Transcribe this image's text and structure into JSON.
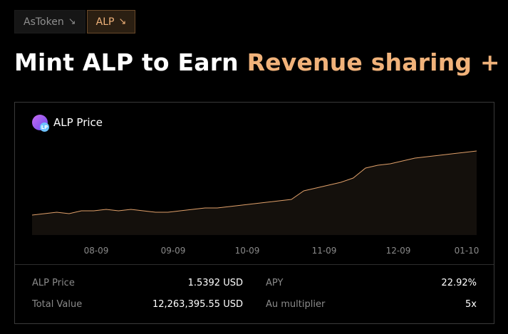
{
  "tabs": [
    {
      "label": "AsToken",
      "icon": "arrow-down-right-icon",
      "active": false
    },
    {
      "label": "ALP",
      "icon": "arrow-down-right-icon",
      "active": true
    }
  ],
  "headline": {
    "main": "Mint ALP to Earn ",
    "accent": "Revenue sharing + A"
  },
  "colors": {
    "accent": "#f0b27a",
    "line": "#e0a06a"
  },
  "card": {
    "title": "ALP Price",
    "logo_badge": "LP"
  },
  "chart_data": {
    "type": "area",
    "x_ticks": [
      "08-09",
      "09-09",
      "10-09",
      "11-09",
      "12-09",
      "01-10"
    ],
    "series": [
      {
        "values": [
          1.09,
          1.1,
          1.11,
          1.1,
          1.12,
          1.12,
          1.13,
          1.12,
          1.13,
          1.12,
          1.11,
          1.11,
          1.12,
          1.13,
          1.14,
          1.14,
          1.15,
          1.16,
          1.17,
          1.18,
          1.19,
          1.2,
          1.26,
          1.28,
          1.3,
          1.32,
          1.35,
          1.42,
          1.44,
          1.45,
          1.47,
          1.49,
          1.5,
          1.51,
          1.52,
          1.53,
          1.54
        ]
      }
    ],
    "grid": false
  },
  "stats": {
    "alp_price_label": "ALP Price",
    "alp_price_value": "1.5392 USD",
    "total_value_label": "Total Value",
    "total_value_value": "12,263,395.55 USD",
    "apy_label": "APY",
    "apy_value": "22.92%",
    "au_multiplier_label": "Au multiplier",
    "au_multiplier_value": "5x"
  }
}
